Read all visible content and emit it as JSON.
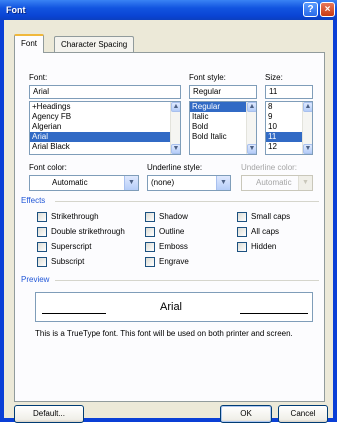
{
  "window": {
    "title": "Font",
    "help": "?",
    "close": "×"
  },
  "tabs": [
    {
      "label": "Font",
      "active": true
    },
    {
      "label": "Character Spacing",
      "active": false
    }
  ],
  "font": {
    "label": "Font:",
    "value": "Arial",
    "items": [
      "+Headings",
      "Agency FB",
      "Algerian",
      "Arial",
      "Arial Black"
    ],
    "selected": "Arial"
  },
  "style": {
    "label": "Font style:",
    "value": "Regular",
    "items": [
      "Regular",
      "Italic",
      "Bold",
      "Bold Italic"
    ],
    "selected": "Regular"
  },
  "size": {
    "label": "Size:",
    "value": "11",
    "items": [
      "8",
      "9",
      "10",
      "11",
      "12"
    ],
    "selected": "11"
  },
  "font_color": {
    "label": "Font color:",
    "value": "Automatic"
  },
  "underline_style": {
    "label": "Underline style:",
    "value": "(none)"
  },
  "underline_color": {
    "label": "Underline color:",
    "value": "Automatic"
  },
  "effects": {
    "header": "Effects",
    "col1": [
      "Strikethrough",
      "Double strikethrough",
      "Superscript",
      "Subscript"
    ],
    "col2": [
      "Shadow",
      "Outline",
      "Emboss",
      "Engrave"
    ],
    "col3": [
      "Small caps",
      "All caps",
      "Hidden"
    ]
  },
  "preview": {
    "header": "Preview",
    "sample": "Arial",
    "note": "This is a TrueType font. This font will be used on both printer and screen."
  },
  "buttons": {
    "default": "Default...",
    "ok": "OK",
    "cancel": "Cancel"
  },
  "colors": {
    "accent": "#316ac5",
    "titlebar": "#0a44d4",
    "section": "#2157d8"
  }
}
